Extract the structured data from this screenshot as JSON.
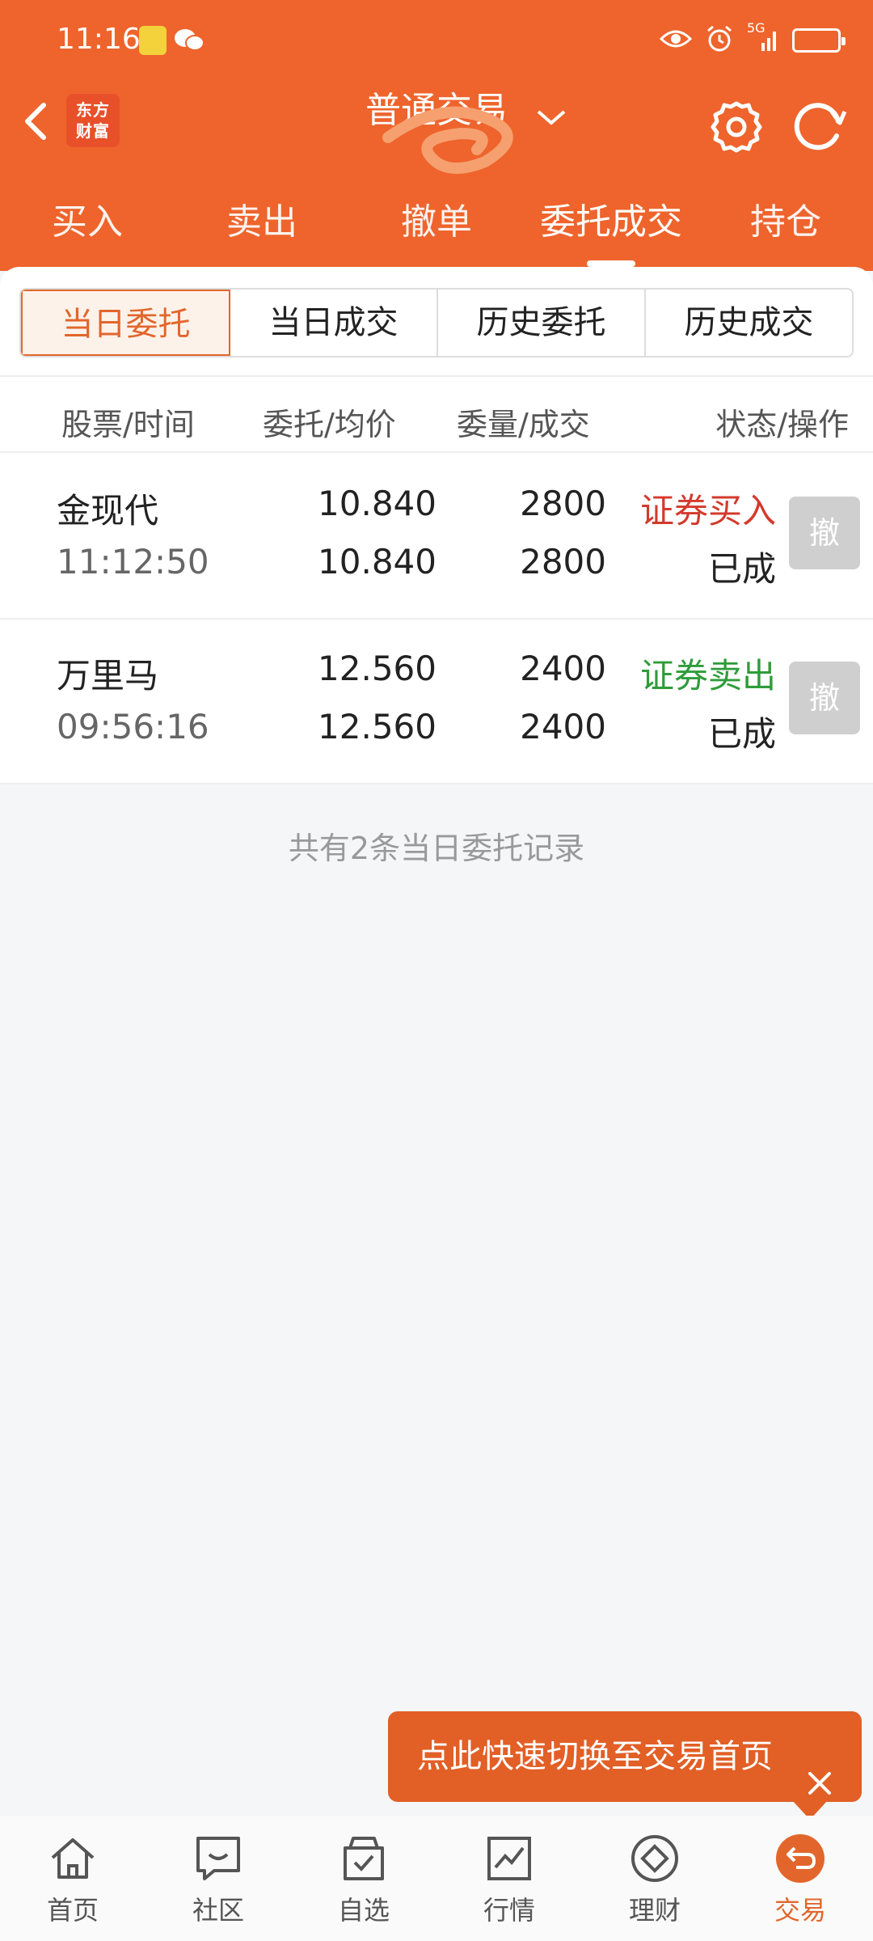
{
  "status": {
    "time": "11:16",
    "signal_label": "5G"
  },
  "header": {
    "title": "普通交易",
    "logo_text": "东方财富"
  },
  "tabs": [
    {
      "label": "买入"
    },
    {
      "label": "卖出"
    },
    {
      "label": "撤单"
    },
    {
      "label": "委托成交"
    },
    {
      "label": "持仓"
    }
  ],
  "segments": [
    {
      "label": "当日委托"
    },
    {
      "label": "当日成交"
    },
    {
      "label": "历史委托"
    },
    {
      "label": "历史成交"
    }
  ],
  "table": {
    "headers": [
      "股票/时间",
      "委托/均价",
      "委量/成交",
      "状态/操作"
    ],
    "rows": [
      {
        "name": "金现代",
        "time": "11:12:50",
        "order_price": "10.840",
        "avg_price": "10.840",
        "order_qty": "2800",
        "filled_qty": "2800",
        "type": "证券买入",
        "type_color": "#d33a2c",
        "status": "已成",
        "action": "撤"
      },
      {
        "name": "万里马",
        "time": "09:56:16",
        "order_price": "12.560",
        "avg_price": "12.560",
        "order_qty": "2400",
        "filled_qty": "2400",
        "type": "证券卖出",
        "type_color": "#2f9c3a",
        "status": "已成",
        "action": "撤"
      }
    ],
    "summary": "共有2条当日委托记录"
  },
  "tooltip": {
    "text": "点此快速切换至交易首页"
  },
  "bottom_nav": [
    {
      "label": "首页",
      "icon": "home-icon"
    },
    {
      "label": "社区",
      "icon": "chat-icon"
    },
    {
      "label": "自选",
      "icon": "watchlist-icon"
    },
    {
      "label": "行情",
      "icon": "market-chart-icon"
    },
    {
      "label": "理财",
      "icon": "diamond-icon"
    },
    {
      "label": "交易",
      "icon": "trade-icon"
    }
  ],
  "colors": {
    "brand": "#ee642c",
    "accent": "#e2662c"
  }
}
